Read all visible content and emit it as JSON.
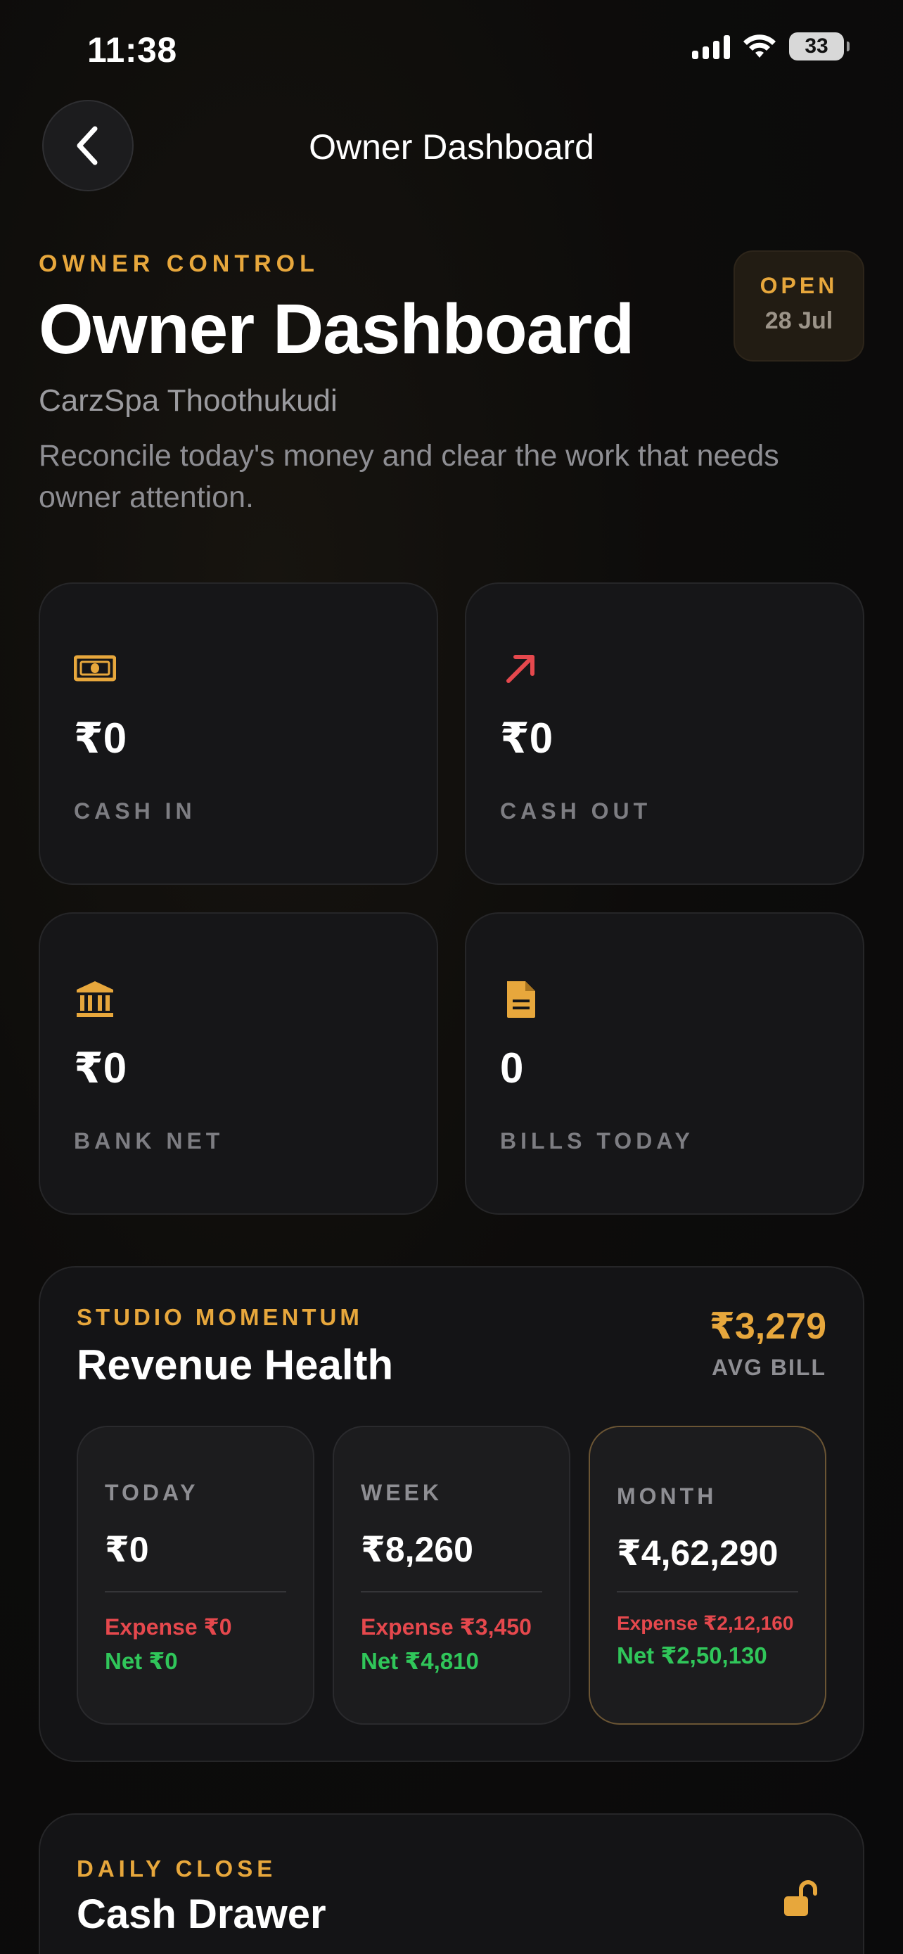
{
  "status_bar": {
    "time": "11:38",
    "battery": "33"
  },
  "nav": {
    "title": "Owner Dashboard"
  },
  "hero": {
    "eyebrow": "OWNER CONTROL",
    "title": "Owner Dashboard",
    "business_name": "CarzSpa Thoothukudi",
    "description": "Reconcile today's money and clear the work that needs owner attention.",
    "badge_status": "OPEN",
    "badge_date": "28 Jul"
  },
  "stats": [
    {
      "value": "₹0",
      "label": "CASH IN",
      "icon": "cash-icon",
      "color": "#e7a73c"
    },
    {
      "value": "₹0",
      "label": "CASH OUT",
      "icon": "arrow-up-right-icon",
      "color": "#e5484d"
    },
    {
      "value": "₹0",
      "label": "BANK NET",
      "icon": "bank-icon",
      "color": "#e7a73c"
    },
    {
      "value": "0",
      "label": "BILLS TODAY",
      "icon": "document-icon",
      "color": "#e7a73c"
    }
  ],
  "revenue": {
    "eyebrow": "STUDIO MOMENTUM",
    "title": "Revenue Health",
    "avg_bill_value": "₹3,279",
    "avg_bill_label": "AVG BILL",
    "periods": [
      {
        "label": "TODAY",
        "value": "₹0",
        "expense": "Expense ₹0",
        "net": "Net ₹0",
        "selected": false
      },
      {
        "label": "WEEK",
        "value": "₹8,260",
        "expense": "Expense ₹3,450",
        "net": "Net ₹4,810",
        "selected": false
      },
      {
        "label": "MONTH",
        "value": "₹4,62,290",
        "expense": "Expense ₹2,12,160",
        "net": "Net ₹2,50,130",
        "selected": true
      }
    ]
  },
  "daily_close": {
    "eyebrow": "DAILY CLOSE",
    "title": "Cash Drawer",
    "icon": "unlocked-lock-icon"
  },
  "colors": {
    "accent": "#e7a73c",
    "expense": "#e5484d",
    "net": "#30c65a",
    "background": "#0b0b0c",
    "card": "#161618"
  }
}
